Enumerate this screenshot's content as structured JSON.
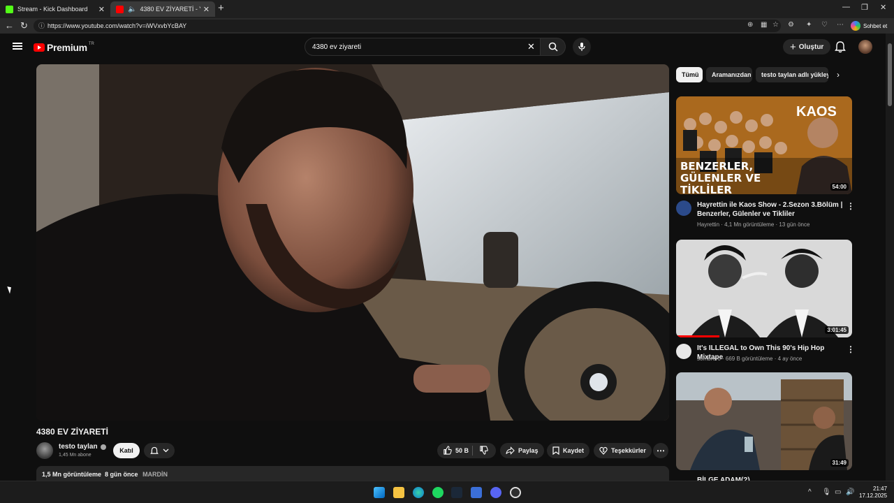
{
  "browser": {
    "tabs": [
      {
        "label": "Stream - Kick Dashboard",
        "favicon_color": "#53fc18"
      },
      {
        "label": "4380 EV ZİYARETİ - YouTube",
        "favicon_color": "#ff0000"
      }
    ],
    "url": "https://www.youtube.com/watch?v=iWVxvbYcBAY",
    "chat_button": "Sohbet et"
  },
  "youtube": {
    "logo_text": "Premium",
    "country_code": "TR",
    "search_value": "4380 ev ziyareti",
    "create_label": "Oluştur"
  },
  "video": {
    "title": "4380 EV ZİYARETİ",
    "channel": "testo taylan",
    "subscribers": "1,45 Mn abone",
    "join_label": "Katıl",
    "likes": "50 B",
    "share_label": "Paylaş",
    "save_label": "Kaydet",
    "thanks_label": "Teşekkürler",
    "views": "1,5 Mn görüntüleme",
    "age": "8 gün önce",
    "location": "MARDİN"
  },
  "chips": [
    {
      "label": "Tümü"
    },
    {
      "label": "Aramanızdan"
    },
    {
      "label": "testo taylan adlı yükleyici"
    }
  ],
  "recommendations": [
    {
      "title": "Hayrettin ile Kaos Show - 2.Sezon 3.Bölüm | Benzerler, Gülenler ve Tikliler",
      "channel": "Hayrettin",
      "views": "4,1 Mn görüntüleme",
      "age": "13 gün önce",
      "duration": "54:00",
      "thumb_text": "BENZERLER, GÜLENLER VE TİKLİLER",
      "thumb_logo": "KAOS"
    },
    {
      "title": "It's ILLEGAL to Own This 90's Hip Hop Mixtape",
      "channel": "sombrero",
      "views": "669 B görüntüleme",
      "age": "4 ay önce",
      "duration": "3:01:45"
    },
    {
      "title": "BİLGE ADAM(?)",
      "duration": "31:49"
    }
  ],
  "taskbar": {
    "time": "21:47",
    "date": "17.12.2025"
  }
}
